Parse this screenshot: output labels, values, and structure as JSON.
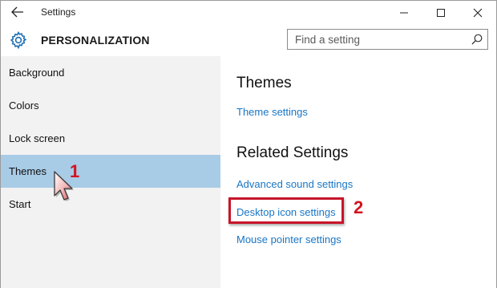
{
  "window": {
    "title": "Settings",
    "controls": {
      "minimize": "—",
      "maximize": "☐",
      "close": "✕"
    }
  },
  "header": {
    "title": "PERSONALIZATION",
    "search": {
      "placeholder": "Find a setting"
    }
  },
  "sidebar": {
    "items": [
      {
        "label": "Background",
        "active": false
      },
      {
        "label": "Colors",
        "active": false
      },
      {
        "label": "Lock screen",
        "active": false
      },
      {
        "label": "Themes",
        "active": true
      },
      {
        "label": "Start",
        "active": false
      }
    ]
  },
  "main": {
    "themes_heading": "Themes",
    "theme_settings_link": "Theme settings",
    "related_heading": "Related Settings",
    "links": {
      "advanced_sound": "Advanced sound settings",
      "desktop_icon": "Desktop icon settings",
      "mouse_pointer": "Mouse pointer settings"
    }
  },
  "annotations": {
    "step1": "1",
    "step2": "2",
    "color": "#d3131f"
  },
  "colors": {
    "accent_link": "#1976c4",
    "selected_nav": "#a8cbe6",
    "sidebar_bg": "#f2f2f2"
  }
}
